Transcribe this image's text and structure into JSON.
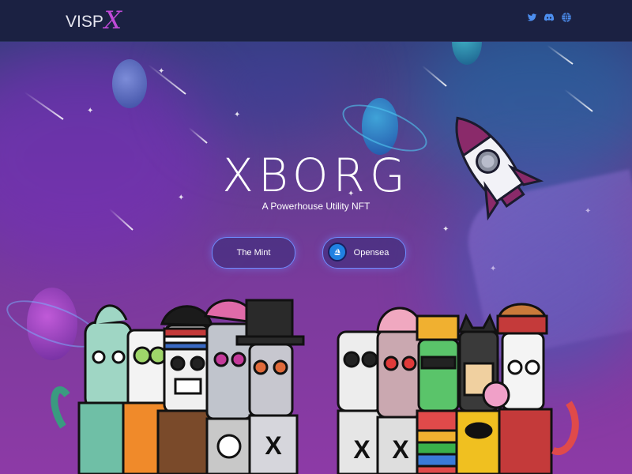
{
  "nav": {
    "logo_text": "VISP",
    "logo_mark": "X",
    "social_icons": [
      "twitter-icon",
      "discord-icon",
      "globe-icon"
    ]
  },
  "hero": {
    "title": "XBORG",
    "subtitle": "A Powerhouse Utility NFT"
  },
  "buttons": {
    "mint_label": "The Mint",
    "opensea_label": "Opensea"
  },
  "colors": {
    "nav_bg": "#1b2142",
    "accent": "#6e8cff",
    "logo_x": "#c04ad8",
    "social": "#4d8ff0"
  }
}
